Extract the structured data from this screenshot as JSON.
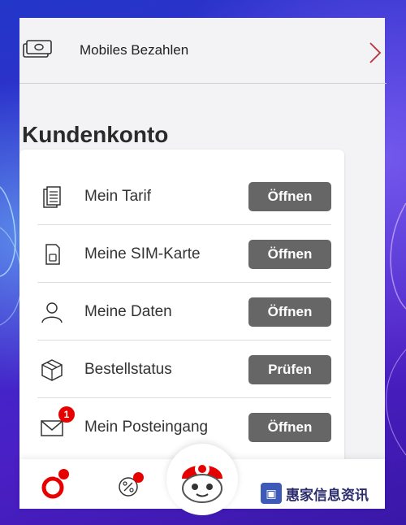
{
  "payment": {
    "label": "Mobiles Bezahlen",
    "icon": "cash-icon"
  },
  "section": {
    "title": "Kundenkonto"
  },
  "items": [
    {
      "label": "Mein Tarif",
      "button": "Öffnen",
      "icon": "documents-icon"
    },
    {
      "label": "Meine SIM-Karte",
      "button": "Öffnen",
      "icon": "sim-card-icon"
    },
    {
      "label": "Meine Daten",
      "button": "Öffnen",
      "icon": "person-icon"
    },
    {
      "label": "Bestellstatus",
      "button": "Prüfen",
      "icon": "package-icon"
    },
    {
      "label": "Mein Posteingang",
      "button": "Öffnen",
      "icon": "envelope-icon",
      "badge": "1"
    }
  ],
  "tabbar": {
    "tabs": [
      {
        "name": "vodafone-home",
        "icon": "vodafone-logo-icon"
      },
      {
        "name": "offers",
        "icon": "percent-icon"
      },
      {
        "name": "assistant",
        "icon": "tobi-bot-icon"
      }
    ]
  },
  "watermark": {
    "text": "惠家信息资讯"
  },
  "colors": {
    "accent": "#e60000",
    "button": "#666666",
    "card": "#f3f2f4"
  }
}
